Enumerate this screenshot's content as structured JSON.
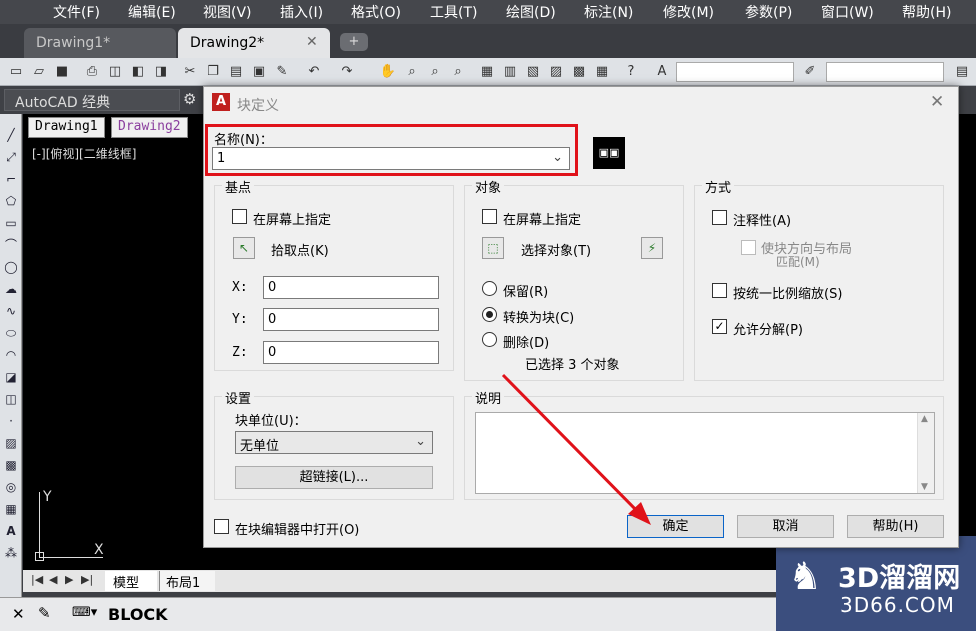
{
  "menus": [
    "文件(F)",
    "编辑(E)",
    "视图(V)",
    "插入(I)",
    "格式(O)",
    "工具(T)",
    "绘图(D)",
    "标注(N)",
    "修改(M)",
    "参数(P)",
    "窗口(W)",
    "帮助(H)"
  ],
  "doc_tabs": [
    "Drawing1*",
    "Drawing2*"
  ],
  "workspace": "AutoCAD 经典",
  "drawing_tabs": [
    "Drawing1",
    "Drawing2"
  ],
  "viewport_label": "[-][俯视][二维线框]",
  "ucs": {
    "y": "Y",
    "x": "X"
  },
  "layout_tabs": [
    "模型",
    "布局1"
  ],
  "command": "BLOCK",
  "watermark": {
    "brand": "3D溜溜网",
    "url": "3D66.COM"
  },
  "dialog": {
    "title": "块定义",
    "name_label": "名称(N)：",
    "name_value": "1",
    "basepoint": {
      "title": "基点",
      "onscreen": "在屏幕上指定",
      "pick": "拾取点(K)",
      "x_label": "X:",
      "x": "0",
      "y_label": "Y:",
      "y": "0",
      "z_label": "Z:",
      "z": "0"
    },
    "objects": {
      "title": "对象",
      "onscreen": "在屏幕上指定",
      "select": "选择对象(T)",
      "retain": "保留(R)",
      "convert": "转换为块(C)",
      "delete": "删除(D)",
      "status": "已选择 3 个对象"
    },
    "behavior": {
      "title": "方式",
      "annotative": "注释性(A)",
      "match1": "使块方向与布局",
      "match2": "匹配(M)",
      "scale": "按统一比例缩放(S)",
      "explode": "允许分解(P)"
    },
    "settings": {
      "title": "设置",
      "unit_label": "块单位(U)：",
      "unit_value": "无单位",
      "hyperlink": "超链接(L)..."
    },
    "description_label": "说明",
    "open_in_editor": "在块编辑器中打开(O)",
    "ok": "确定",
    "cancel": "取消",
    "help": "帮助(H)"
  }
}
